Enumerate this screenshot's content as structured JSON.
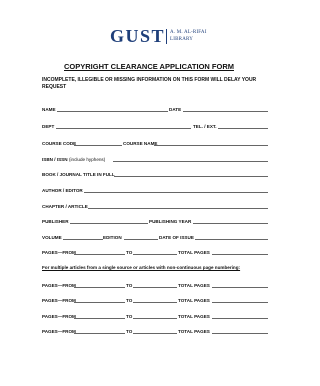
{
  "header": {
    "logo_text": "GUST",
    "logo_sub_line1": "A. M. AL-RIFAI",
    "logo_sub_line2": "LIBRARY",
    "brand_color": "#1f3f7a"
  },
  "form": {
    "title": "COPYRIGHT CLEARANCE APPLICATION FORM",
    "warning": "INCOMPLETE, ILLEGIBLE OR MISSING INFORMATION ON THIS FORM WILL DELAY YOUR REQUEST",
    "fields": {
      "name": "NAME",
      "date": "DATE",
      "dept": "DEPT",
      "tel": "TEL. / EXT.",
      "course_code": "COURSE CODE",
      "course_name": "COURSE NAME",
      "isbn": "ISBN / ISSN",
      "isbn_note": "(include hyphens)",
      "book_title": "BOOK / JOURNAL TITLE IN FULL",
      "author": "AUTHOR / EDITOR",
      "chapter": "CHAPTER / ARTICLE",
      "publisher": "PUBLISHER",
      "publishing_year": "PUBLISHING YEAR",
      "volume": "VOLUME",
      "edition": "EDITION",
      "date_of_issue": "DATE OF ISSUE",
      "pages_from": "PAGES—FROM",
      "to": "TO",
      "total_pages": "TOTAL PAGES"
    },
    "multi_note": "For multiple articles from a single source or articles with non-continuous page numbering:"
  }
}
